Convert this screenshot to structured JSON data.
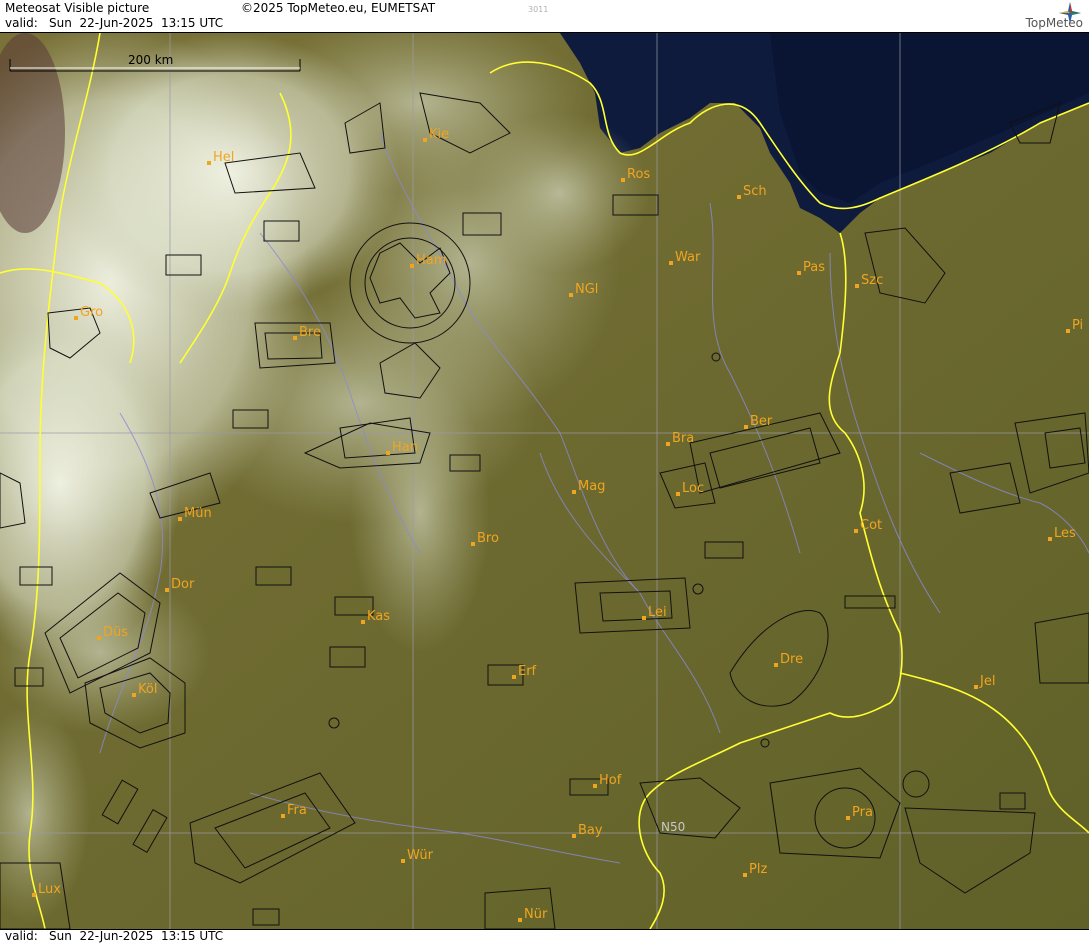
{
  "header": {
    "title": "Meteosat Visible picture",
    "copyright": "©2025 TopMeteo.eu, EUMETSAT",
    "frame_id": "3011",
    "valid_label": "valid:",
    "valid_time": "Sun  22-Jun-2025  13:15 UTC"
  },
  "logo": {
    "text": "TopMeteo",
    "icon": "compass-star-icon"
  },
  "scale": {
    "label": "200 km"
  },
  "grid": {
    "label": "N50"
  },
  "cities": [
    {
      "name": "Kie"
    },
    {
      "name": "Hel"
    },
    {
      "name": "Ros"
    },
    {
      "name": "Sch"
    },
    {
      "name": "Ham"
    },
    {
      "name": "War"
    },
    {
      "name": "Pas"
    },
    {
      "name": "Szc"
    },
    {
      "name": "NGl"
    },
    {
      "name": "Gro"
    },
    {
      "name": "Bre"
    },
    {
      "name": "Pi"
    },
    {
      "name": "Ber"
    },
    {
      "name": "Han"
    },
    {
      "name": "Bra"
    },
    {
      "name": "Mag"
    },
    {
      "name": "Loc"
    },
    {
      "name": "Mün"
    },
    {
      "name": "Cot"
    },
    {
      "name": "Les"
    },
    {
      "name": "Bro"
    },
    {
      "name": "Dor"
    },
    {
      "name": "Kas"
    },
    {
      "name": "Lei"
    },
    {
      "name": "Düs"
    },
    {
      "name": "Dre"
    },
    {
      "name": "Erf"
    },
    {
      "name": "Köl"
    },
    {
      "name": "Jel"
    },
    {
      "name": "Hof"
    },
    {
      "name": "Fra"
    },
    {
      "name": "Pra"
    },
    {
      "name": "Bay"
    },
    {
      "name": "Wür"
    },
    {
      "name": "Plz"
    },
    {
      "name": "Lux"
    },
    {
      "name": "Nür"
    }
  ],
  "colors": {
    "land": "#6f6a2a",
    "sea": "#0d1a3a",
    "cloud": "#e8ecd8",
    "border": "#ffff33",
    "city": "#f0a520"
  },
  "footer": {
    "valid_label": "valid:",
    "valid_time": "Sun  22-Jun-2025  13:15 UTC"
  }
}
